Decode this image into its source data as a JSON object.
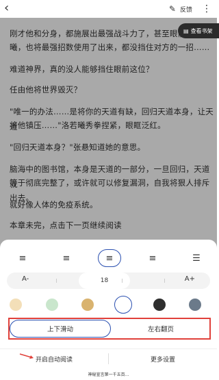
{
  "topbar": {
    "back_icon": "back-arrow-icon",
    "feedback_label": "反馈",
    "more_icon": "more-vertical-icon"
  },
  "reader": {
    "shelf_label": "查看书架",
    "paragraphs": [
      "刚才他和分身，都施展出最强战斗力了，甚至眼前的这个",
      "曦，也将最强招数使用了出来，都没挡住对方的一招……",
      "难道神界，真的没人能够挡住眼前这位？",
      "任由他将世界毁灭？",
      "\"唯一的办法……是将你的天道有缺，回归天道本身，让天道",
      "将他镇压……\"洛若曦秀拳捏紧，眼眶泛红。",
      "\"回归天道本身？\"张悬知道她的意思。",
      "脑海中的图书馆，本身是天道的一部分，一旦回归，天道就",
      "等于彻底完整了，或许就可以修复漏洞，自我将狠人排斥出去。",
      "就好像人体的免疫系统。",
      "本章未完，点击下一页继续阅读"
    ]
  },
  "settings": {
    "align_icons": [
      "align-compact-icon",
      "align-normal-icon",
      "align-wide-icon",
      "align-wider-icon",
      "align-widest-icon"
    ],
    "font_decrease": "A-",
    "font_size": "18",
    "font_increase": "A+",
    "bg_colors": [
      "#f3dfb8",
      "#c9e6cc",
      "#d9b36f",
      "#ffffff",
      "#2f2f2f",
      "#6b7a8a"
    ],
    "mode_scroll": "上下滑动",
    "mode_page": "左右翻页",
    "auto_read": "开启自动阅读",
    "more_settings": "更多设置"
  },
  "footer": {
    "text": "神秘宣言第一千五百..."
  }
}
